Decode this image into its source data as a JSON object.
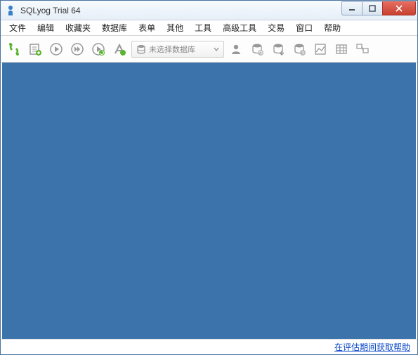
{
  "title": "SQLyog Trial 64",
  "menu": {
    "file": "文件",
    "edit": "编辑",
    "favorites": "收藏夹",
    "database": "数据库",
    "table": "表单",
    "other": "其他",
    "tools": "工具",
    "powertools": "高级工具",
    "trade": "交易",
    "window": "窗口",
    "help": "帮助"
  },
  "db_placeholder": "未选择数据库",
  "status_link": "在评估期间获取帮助"
}
